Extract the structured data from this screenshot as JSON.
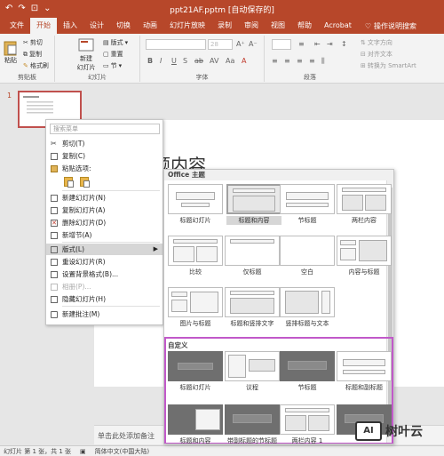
{
  "titlebar": {
    "title": "ppt21AF.pptm [自动保存的] ",
    "qat_icons": [
      "undo-icon",
      "redo-icon",
      "start-icon",
      "dropdown-icon"
    ]
  },
  "tabs": [
    {
      "label": "文件"
    },
    {
      "label": "开始"
    },
    {
      "label": "插入"
    },
    {
      "label": "设计"
    },
    {
      "label": "切换"
    },
    {
      "label": "动画"
    },
    {
      "label": "幻灯片放映"
    },
    {
      "label": "录制"
    },
    {
      "label": "审阅"
    },
    {
      "label": "视图"
    },
    {
      "label": "帮助"
    },
    {
      "label": "Acrobat"
    }
  ],
  "tell_me": "操作说明搜索",
  "ribbon": {
    "paste": "粘贴",
    "cut": "剪切",
    "copy": "复制",
    "format_painter": "格式刷",
    "clipboard_group": "剪贴板",
    "new_slide": "新建\n幻灯片",
    "layout": "版式",
    "reset": "重置",
    "section": "节",
    "slides_group": "幻灯片",
    "font_group": "字体",
    "font_size": "28",
    "paragraph_group": "段落",
    "text_direction": "文字方向",
    "align_text": "对齐文本",
    "smartart": "转换为 SmartArt"
  },
  "thumbnail": {
    "number": "1"
  },
  "slide": {
    "title_fragment": "题内容"
  },
  "notes_placeholder": "单击此处添加备注",
  "status": {
    "slide_info": "幻灯片 第 1 张，共 1 张",
    "language": "简体中文(中国大陆)"
  },
  "context_menu": {
    "search_placeholder": "搜索菜单",
    "items": [
      {
        "label": "剪切(T)",
        "icon": "scissors-icon",
        "enabled": true
      },
      {
        "label": "复制(C)",
        "icon": "copy-icon",
        "enabled": true
      },
      {
        "label": "粘贴选项:",
        "icon": "paste-icon",
        "enabled": true
      },
      {
        "label": "新建幻灯片(N)",
        "icon": "new-slide-icon",
        "enabled": true
      },
      {
        "label": "复制幻灯片(A)",
        "icon": "duplicate-slide-icon",
        "enabled": true
      },
      {
        "label": "删除幻灯片(D)",
        "icon": "delete-slide-icon",
        "enabled": true
      },
      {
        "label": "新增节(A)",
        "icon": "section-icon",
        "enabled": true
      },
      {
        "label": "版式(L)",
        "icon": "layout-icon",
        "enabled": true
      },
      {
        "label": "重设幻灯片(R)",
        "icon": "reset-slide-icon",
        "enabled": true
      },
      {
        "label": "设置背景格式(B)...",
        "icon": "background-icon",
        "enabled": true
      },
      {
        "label": "相册(P)...",
        "icon": "album-icon",
        "enabled": false
      },
      {
        "label": "隐藏幻灯片(H)",
        "icon": "hide-slide-icon",
        "enabled": true
      },
      {
        "label": "新建批注(M)",
        "icon": "comment-icon",
        "enabled": true
      }
    ]
  },
  "gallery": {
    "office_header": "Office 主题",
    "office_layouts": [
      "标题幻灯片",
      "标题和内容",
      "节标题",
      "两栏内容",
      "比较",
      "仅标题",
      "空白",
      "内容与标题",
      "图片与标题",
      "标题和竖排文字",
      "竖排标题与文本"
    ],
    "custom_header": "自定义",
    "custom_layouts": [
      "标题幻灯片",
      "议程",
      "节标题",
      "标题和副标题",
      "标题和内容",
      "带副标题的节标题",
      "两栏内容 1",
      ""
    ]
  },
  "watermark": {
    "logo": "AI",
    "brand": "树叶云"
  }
}
